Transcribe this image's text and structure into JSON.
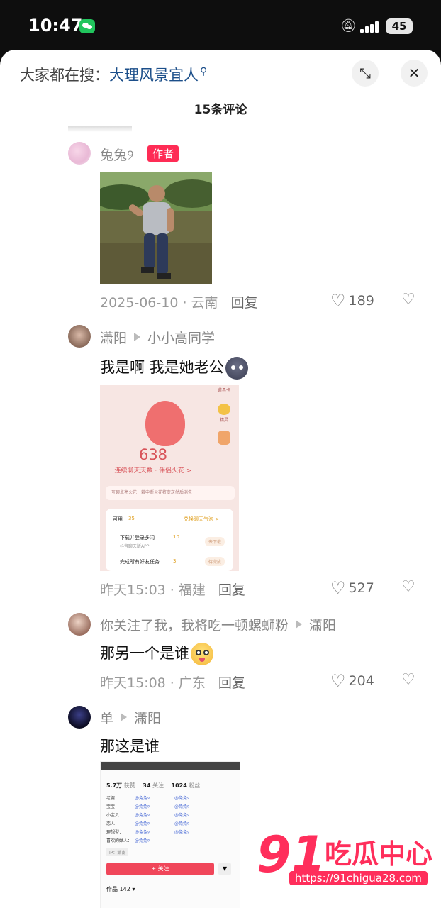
{
  "status": {
    "time": "10:47",
    "battery": "45"
  },
  "header": {
    "search_prefix": "大家都在搜：",
    "search_term": "大理风景宜人",
    "search_icon": "search-icon",
    "collapse_icon": "collapse-icon",
    "close_icon": "close-icon",
    "comment_count": "15条评论"
  },
  "comments": [
    {
      "user": "兔兔୨",
      "tag": "作者",
      "date": "2025-06-10",
      "location": "云南",
      "reply": "回复",
      "likes": "189"
    },
    {
      "user": "潇阳",
      "reply_to": "小小高同学",
      "text": "我是啊 我是她老公",
      "date": "昨天15:03",
      "location": "福建",
      "reply": "回复",
      "likes": "527",
      "screenshot": {
        "number": "638",
        "subtitle": "连续聊天天数 · 伴侣火花 >",
        "tip": "互聊点亮火花，若中断火花将变灰然后消失",
        "available": "可用",
        "points": "35",
        "exchange": "兑换聊天气泡 >",
        "task1": "下载并登录多闪",
        "task1_points": "10",
        "task1_sub": "抖音聊天版APP",
        "task1_btn": "去下载",
        "task2": "完成所有好友任务",
        "task2_points": "3",
        "task2_btn": "待完成",
        "side1": "道具卡",
        "side2": "精灵"
      }
    },
    {
      "user": "你关注了我，我将吃一顿螺蛳粉",
      "reply_to": "潇阳",
      "text": "那另一个是谁",
      "date": "昨天15:08",
      "location": "广东",
      "reply": "回复",
      "likes": "204"
    },
    {
      "user": "单",
      "reply_to": "潇阳",
      "text": "那这是谁",
      "profile": {
        "likes": "5.7万",
        "likes_label": "获赞",
        "following": "34",
        "following_label": "关注",
        "followers": "1024",
        "followers_label": "粉丝",
        "rows": [
          "老婆：",
          "宝宝：",
          "小宝贝：",
          "恋人：",
          "理想型：",
          "喜欢的姑人："
        ],
        "handle": "@兔兔୨",
        "ip": "IP：湖南",
        "follow_btn": "+ 关注",
        "works": "作品 142 ▾"
      }
    }
  ],
  "watermark": {
    "big": "91",
    "cn": "吃瓜中心",
    "url": "https://91chigua28.com"
  }
}
